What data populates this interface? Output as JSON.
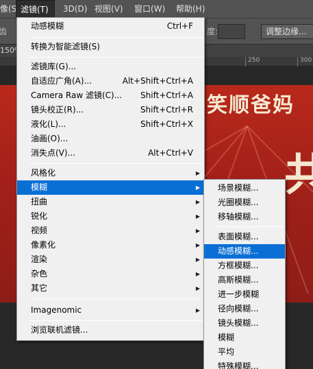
{
  "menubar": {
    "items": [
      {
        "label": "像(S)",
        "active": false
      },
      {
        "label": "滤镜(T)",
        "active": true
      },
      {
        "label": "3D(D)",
        "active": false
      },
      {
        "label": "视图(V)",
        "active": false
      },
      {
        "label": "窗口(W)",
        "active": false
      },
      {
        "label": "帮助(H)",
        "active": false
      }
    ]
  },
  "optionsbar": {
    "left_partial": "齿",
    "field_label_partial": "度:",
    "refine_edge_button": "调整边缘..."
  },
  "doc": {
    "zoom": "150%",
    "ruler_labels": [
      "250",
      "300"
    ]
  },
  "poster": {
    "title": "笑顺爸妈",
    "big_char": "共"
  },
  "filter_menu": {
    "items": [
      {
        "label": "动感模糊",
        "shortcut": "Ctrl+F",
        "submenu": false
      },
      {
        "label": "转换为智能滤镜(S)",
        "shortcut": "",
        "submenu": false
      },
      {
        "label": "滤镜库(G)...",
        "shortcut": "",
        "submenu": false
      },
      {
        "label": "自适应广角(A)...",
        "shortcut": "Alt+Shift+Ctrl+A",
        "submenu": false
      },
      {
        "label": "Camera Raw 滤镜(C)...",
        "shortcut": "Shift+Ctrl+A",
        "submenu": false
      },
      {
        "label": "镜头校正(R)...",
        "shortcut": "Shift+Ctrl+R",
        "submenu": false
      },
      {
        "label": "液化(L)...",
        "shortcut": "Shift+Ctrl+X",
        "submenu": false
      },
      {
        "label": "油画(O)...",
        "shortcut": "",
        "submenu": false
      },
      {
        "label": "消失点(V)...",
        "shortcut": "Alt+Ctrl+V",
        "submenu": false
      },
      {
        "label": "风格化",
        "shortcut": "",
        "submenu": true
      },
      {
        "label": "模糊",
        "shortcut": "",
        "submenu": true,
        "highlighted": true
      },
      {
        "label": "扭曲",
        "shortcut": "",
        "submenu": true
      },
      {
        "label": "锐化",
        "shortcut": "",
        "submenu": true
      },
      {
        "label": "视频",
        "shortcut": "",
        "submenu": true
      },
      {
        "label": "像素化",
        "shortcut": "",
        "submenu": true
      },
      {
        "label": "渲染",
        "shortcut": "",
        "submenu": true
      },
      {
        "label": "杂色",
        "shortcut": "",
        "submenu": true
      },
      {
        "label": "其它",
        "shortcut": "",
        "submenu": true
      },
      {
        "label": "Imagenomic",
        "shortcut": "",
        "submenu": true
      },
      {
        "label": "浏览联机滤镜...",
        "shortcut": "",
        "submenu": false
      }
    ]
  },
  "blur_submenu": {
    "items": [
      {
        "label": "场景模糊..."
      },
      {
        "label": "光圈模糊..."
      },
      {
        "label": "移轴模糊..."
      },
      {
        "label": "表面模糊..."
      },
      {
        "label": "动感模糊...",
        "highlighted": true
      },
      {
        "label": "方框模糊..."
      },
      {
        "label": "高斯模糊..."
      },
      {
        "label": "进一步模糊"
      },
      {
        "label": "径向模糊..."
      },
      {
        "label": "镜头模糊..."
      },
      {
        "label": "模糊"
      },
      {
        "label": "平均"
      },
      {
        "label": "特殊模糊..."
      }
    ]
  },
  "colors": {
    "menu_bg": "#f0f0f0",
    "highlight": "#0a6fd4",
    "app_bar": "#535353",
    "poster_red": "#b9291b"
  }
}
